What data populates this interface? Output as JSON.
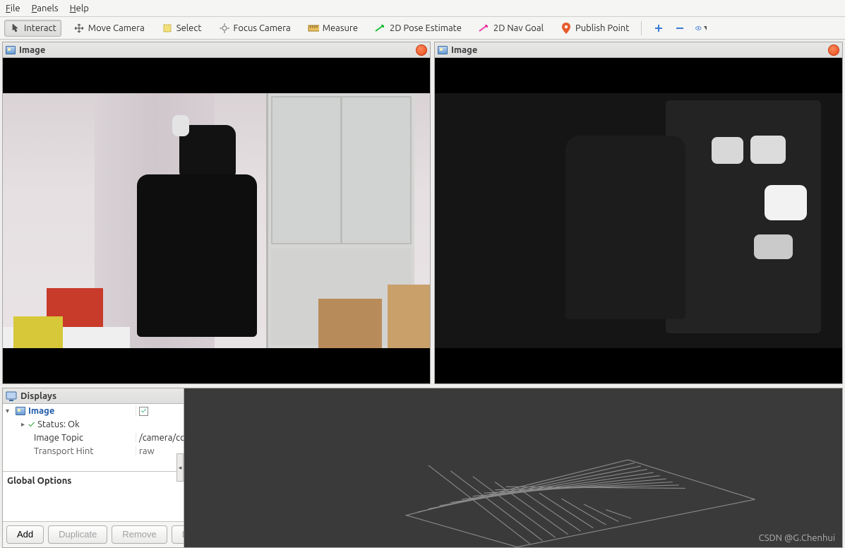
{
  "menubar": {
    "file": "File",
    "panels": "Panels",
    "help": "Help"
  },
  "toolbar": {
    "interact": "Interact",
    "move_camera": "Move Camera",
    "select": "Select",
    "focus_camera": "Focus Camera",
    "measure": "Measure",
    "pose_estimate": "2D Pose Estimate",
    "nav_goal": "2D Nav Goal",
    "publish_point": "Publish Point"
  },
  "panels": {
    "image_left": {
      "title": "Image"
    },
    "image_right": {
      "title": "Image"
    },
    "displays": {
      "title": "Displays"
    }
  },
  "displays_tree": {
    "root_label": "Image",
    "root_checked": true,
    "status_label": "Status: Ok",
    "image_topic_label": "Image Topic",
    "image_topic_value": "/camera/color/imag...",
    "transport_hint_label": "Transport Hint",
    "transport_hint_value": "raw"
  },
  "global_options": {
    "title": "Global Options"
  },
  "buttons": {
    "add": "Add",
    "duplicate": "Duplicate",
    "remove": "Remove",
    "rename": "Rename"
  },
  "watermark": "CSDN @G.Chenhui"
}
